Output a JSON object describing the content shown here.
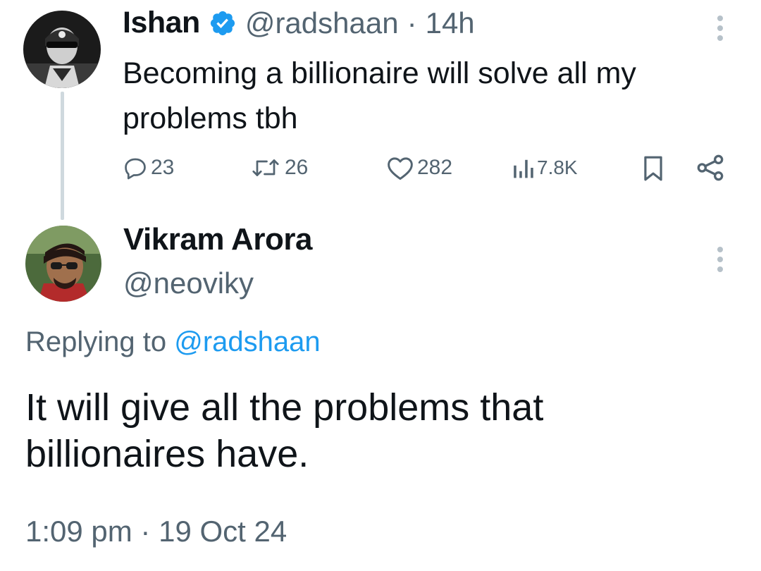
{
  "parent_tweet": {
    "author_name": "Ishan",
    "author_handle": "@radshaan",
    "separator": "·",
    "time_ago": "14h",
    "text": "Becoming a billionaire will solve all my problems tbh",
    "metrics": {
      "replies": "23",
      "retweets": "26",
      "likes": "282",
      "views": "7.8K"
    },
    "icons": [
      "avatar",
      "verified-badge-icon",
      "more-options-icon",
      "reply-icon",
      "retweet-icon",
      "like-icon",
      "views-icon",
      "bookmark-icon",
      "share-icon"
    ]
  },
  "reply_tweet": {
    "author_name": "Vikram Arora",
    "author_handle": "@neoviky",
    "replying_to_prefix": "Replying to",
    "replying_to_handle": "@radshaan",
    "text": "It will give all the problems that billionaires have.",
    "timestamp": "1:09 pm · 19 Oct 24",
    "icons": [
      "avatar",
      "more-options-icon"
    ]
  },
  "colors": {
    "text_primary": "#0f1419",
    "text_secondary": "#536471",
    "accent": "#1d9bf0",
    "thread_line": "#cfd9de"
  }
}
